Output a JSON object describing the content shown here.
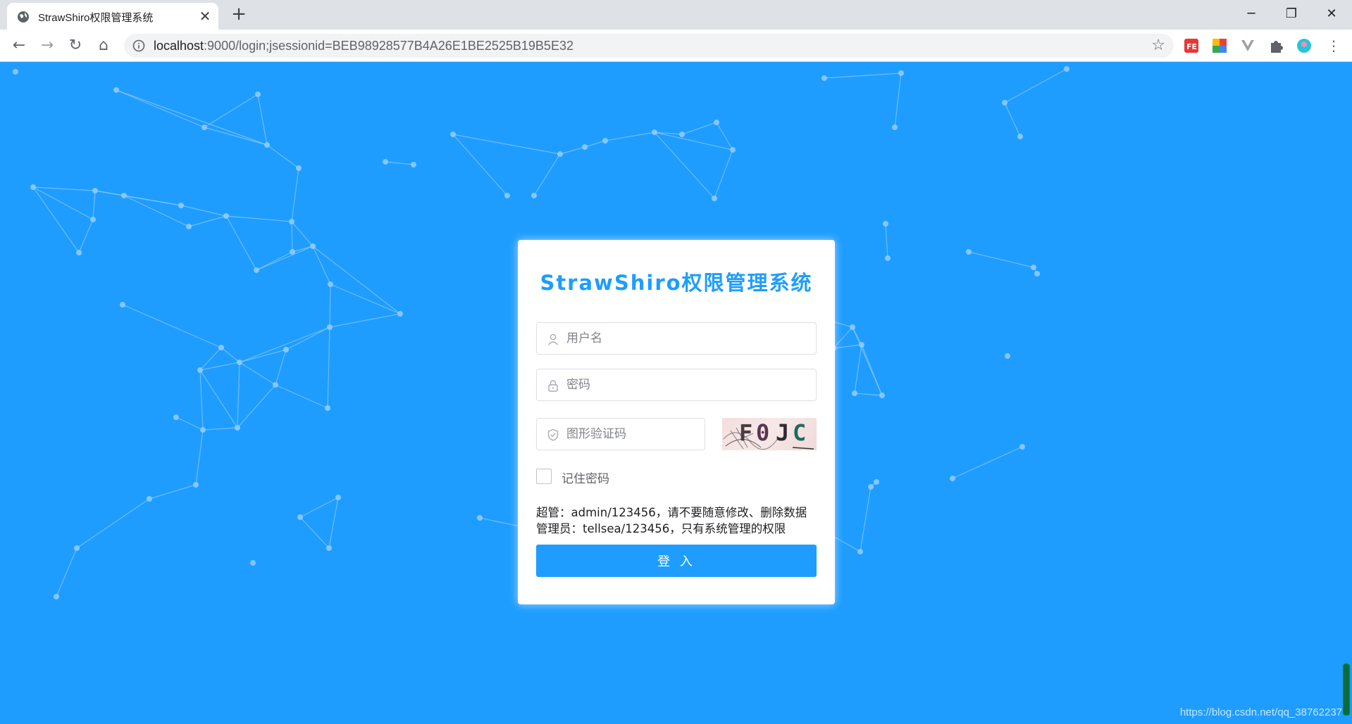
{
  "browser": {
    "tab_title": "StrawShiro权限管理系统",
    "new_tab_label": "+",
    "close_tab_label": "✕",
    "url_host": "localhost",
    "url_rest": ":9000/login;jsessionid=BEB98928577B4A26E1BE2525B19B5E32",
    "window_controls": {
      "minimize": "─",
      "restore": "❐",
      "close": "✕"
    }
  },
  "login": {
    "title": "StrawShiro权限管理系统",
    "username_placeholder": "用户名",
    "password_placeholder": "密码",
    "captcha_placeholder": "图形验证码",
    "captcha_text": [
      "F",
      "0",
      "J",
      "C"
    ],
    "remember_label": "记住密码",
    "hint_admin": "超管：admin/123456，请不要随意修改、删除数据",
    "hint_manager": "管理员：tellsea/123456，只有系统管理的权限",
    "submit_label": "登 入"
  },
  "watermark": "https://blog.csdn.net/qq_38762237",
  "colors": {
    "background": "#1e9dff",
    "accent": "#1e9dff",
    "network_line": "#8fcbff"
  }
}
